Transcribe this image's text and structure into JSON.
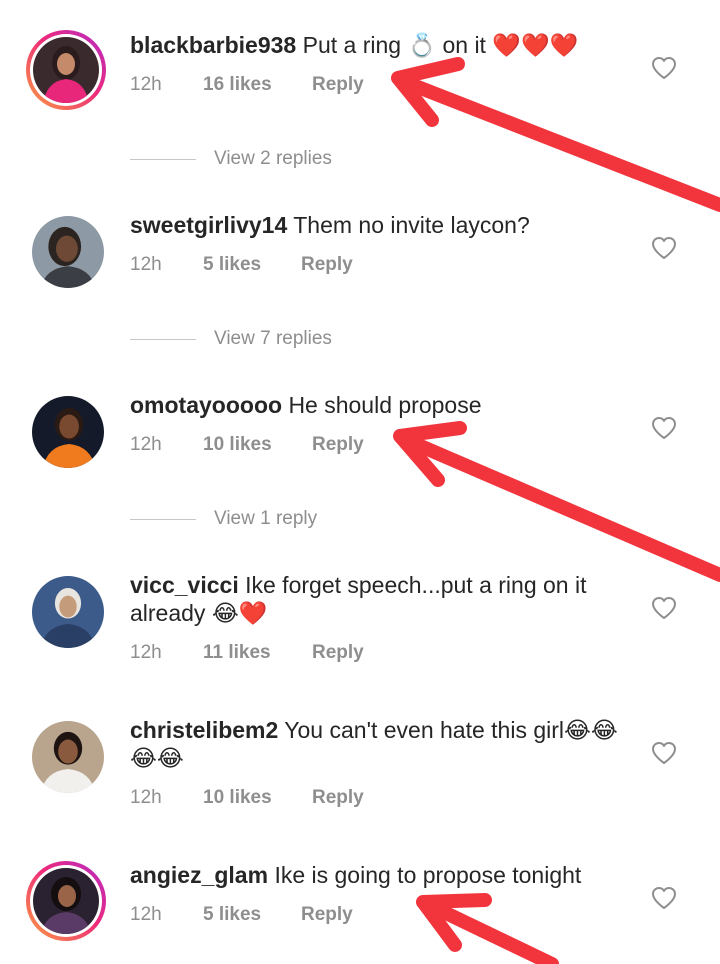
{
  "comments": [
    {
      "username": "blackbarbie938",
      "text": "Put a ring 💍 on it ❤️❤️❤️",
      "time": "12h",
      "likes": "16 likes",
      "reply": "Reply",
      "view_replies": "View 2 replies",
      "avatar_icon": "avatar-woman-pink-dress-icon",
      "story_ring": true
    },
    {
      "username": "sweetgirlivy14",
      "text": "Them no invite laycon?",
      "time": "12h",
      "likes": "5 likes",
      "reply": "Reply",
      "view_replies": "View 7 replies",
      "avatar_icon": "avatar-woman-selfie-icon",
      "story_ring": false
    },
    {
      "username": "omotayooooo",
      "text": "He should propose",
      "time": "12h",
      "likes": "10 likes",
      "reply": "Reply",
      "view_replies": "View 1 reply",
      "avatar_icon": "avatar-woman-orange-top-icon",
      "story_ring": false
    },
    {
      "username": "vicc_vicci",
      "text": "Ike forget speech...put a ring on it already 😂❤️",
      "time": "12h",
      "likes": "11 likes",
      "reply": "Reply",
      "view_replies": "",
      "avatar_icon": "avatar-person-blue-icon",
      "story_ring": false
    },
    {
      "username": "christelibem2",
      "text": "You can't even hate this girl😂😂😂😂",
      "time": "12h",
      "likes": "10 likes",
      "reply": "Reply",
      "view_replies": "",
      "avatar_icon": "avatar-woman-white-outfit-icon",
      "story_ring": false
    },
    {
      "username": "angiez_glam",
      "text": "Ike is going to propose tonight",
      "time": "12h",
      "likes": "5 likes",
      "reply": "Reply",
      "view_replies": "",
      "avatar_icon": "avatar-woman-glam-icon",
      "story_ring": true
    }
  ],
  "icons": {
    "like": "heart-outline-icon",
    "annotation": "red-arrow-icon"
  },
  "colors": {
    "text": "#262626",
    "secondary": "#8e8e8e",
    "annotation_arrow": "#f2353d",
    "story_ring_start": "#f9a03f",
    "story_ring_end": "#b32bc8"
  }
}
